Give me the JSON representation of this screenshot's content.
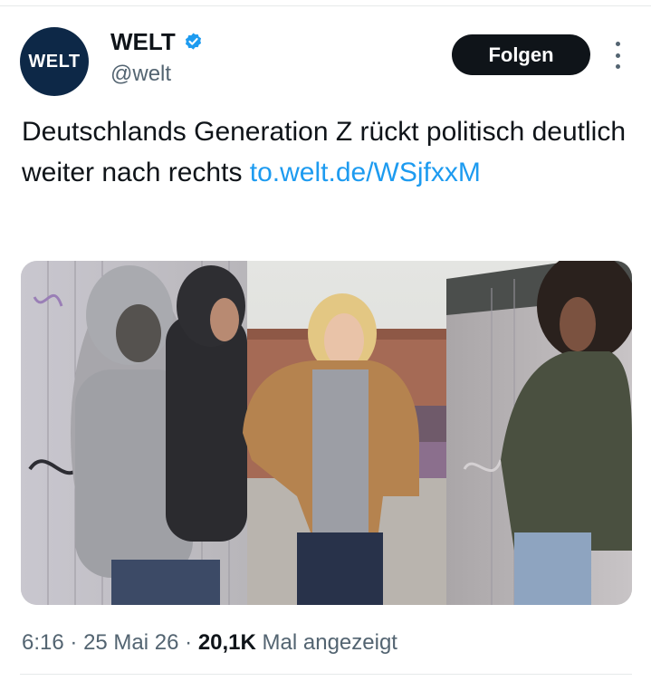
{
  "account": {
    "avatar_text": "WELT",
    "display_name": "WELT",
    "handle": "@welt",
    "verified_icon": "verified-badge-icon"
  },
  "actions": {
    "follow_label": "Folgen",
    "more_icon": "more-options-icon"
  },
  "tweet": {
    "text": "Deutschlands Generation Z rückt politisch deutlich weiter nach rechts ",
    "link_text": "to.welt.de/WSjfxxM"
  },
  "media": {
    "type": "photo"
  },
  "meta": {
    "time": "6:16",
    "separator": "·",
    "date": "25 Mai 26",
    "views": "20,1K",
    "views_label": "Mal angezeigt"
  },
  "colors": {
    "link": "#1d9bf0",
    "avatar_bg": "#0d2847",
    "button_bg": "#0f1419",
    "muted_text": "#536471"
  }
}
